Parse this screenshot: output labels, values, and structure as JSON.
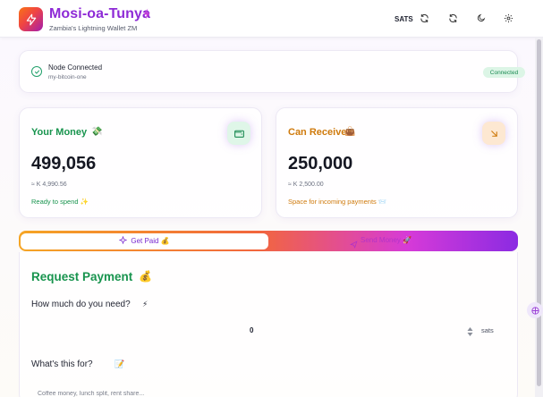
{
  "header": {
    "title": "Mosi-oa-Tunya",
    "subtitle": "Zambia's Lightning Wallet ZM",
    "unit_toggle": "SATS",
    "icons": [
      "lightning-logo-icon",
      "bolt-icon",
      "refresh-icon",
      "sync-icon",
      "moon-icon",
      "gear-icon"
    ]
  },
  "node": {
    "status": "Node Connected",
    "name": "my-bitcoin-one",
    "badge": "Connected"
  },
  "balances": {
    "money": {
      "label": "Your Money",
      "emoji": "💸",
      "value": "499,056",
      "fiat": "≈ K 4,990.56",
      "note": "Ready to spend ✨"
    },
    "receive": {
      "label": "Can Receive",
      "emoji": "👜",
      "value": "250,000",
      "fiat": "≈ K 2,500.00",
      "note": "Space for incoming payments 📨"
    }
  },
  "tabs": {
    "active": "Get Paid 💰",
    "inactive": "Send Money 🚀"
  },
  "form": {
    "title": "Request Payment",
    "title_emoji": "💰",
    "amount_label": "How much do you need?",
    "amount_emoji": "⚡",
    "amount_value": "0",
    "amount_unit": "sats",
    "desc_label": "What's this for?",
    "desc_emoji": "📝",
    "desc_placeholder": "Coffee money, lunch split, rent share..."
  },
  "colors": {
    "brand": "#8e2bd6",
    "money": "#18944e",
    "receive": "#cf7a0c",
    "badge_bg": "#dcf5e6"
  }
}
